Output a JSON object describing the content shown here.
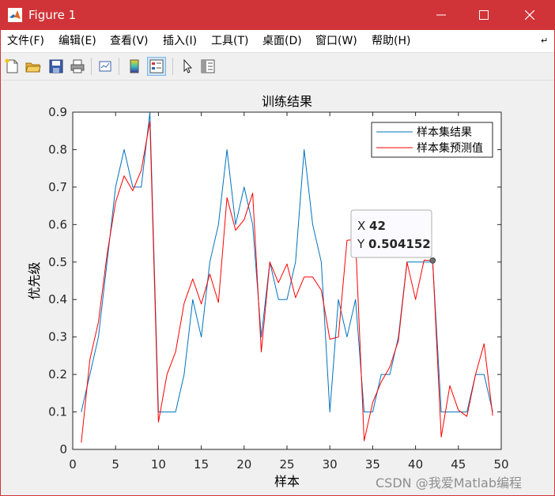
{
  "window": {
    "title": "Figure 1",
    "accent_color": "#d13438"
  },
  "menu": {
    "items": [
      "文件(F)",
      "编辑(E)",
      "查看(V)",
      "插入(I)",
      "工具(T)",
      "桌面(D)",
      "窗口(W)",
      "帮助(H)"
    ]
  },
  "toolbar": {
    "icons": [
      "new-figure-icon",
      "open-file-icon",
      "save-icon",
      "print-icon",
      "link-plot-icon",
      "colorbar-icon",
      "legend-icon",
      "pointer-icon",
      "property-editor-icon"
    ]
  },
  "watermark": "CSDN @我爱Matlab编程",
  "chart_data": {
    "type": "line",
    "title": "训练结果",
    "xlabel": "样本",
    "ylabel": "优先级",
    "xlim": [
      0,
      50
    ],
    "ylim": [
      0,
      0.9
    ],
    "xticks": [
      0,
      5,
      10,
      15,
      20,
      25,
      30,
      35,
      40,
      45,
      50
    ],
    "yticks": [
      0,
      0.1,
      0.2,
      0.3,
      0.4,
      0.5,
      0.6,
      0.7,
      0.8,
      0.9
    ],
    "legend_position": "top-right",
    "series": [
      {
        "name": "样本集结果",
        "color": "#0072bd",
        "x": [
          1,
          2,
          3,
          4,
          5,
          6,
          7,
          8,
          9,
          10,
          11,
          12,
          13,
          14,
          15,
          16,
          17,
          18,
          19,
          20,
          21,
          22,
          23,
          24,
          25,
          26,
          27,
          28,
          29,
          30,
          31,
          32,
          33,
          34,
          35,
          36,
          37,
          38,
          39,
          40,
          41,
          42,
          43,
          44,
          45,
          46,
          47,
          48,
          49
        ],
        "values": [
          0.1,
          0.2,
          0.3,
          0.5,
          0.7,
          0.8,
          0.7,
          0.7,
          0.9,
          0.1,
          0.1,
          0.1,
          0.2,
          0.4,
          0.3,
          0.5,
          0.6,
          0.8,
          0.6,
          0.7,
          0.6,
          0.3,
          0.5,
          0.4,
          0.4,
          0.5,
          0.8,
          0.6,
          0.5,
          0.1,
          0.4,
          0.3,
          0.4,
          0.1,
          0.1,
          0.2,
          0.2,
          0.3,
          0.5,
          0.5,
          0.5,
          0.5,
          0.1,
          0.1,
          0.1,
          0.1,
          0.2,
          0.2,
          0.1
        ]
      },
      {
        "name": "样本集预测值",
        "color": "#ff0000",
        "x": [
          1,
          2,
          3,
          4,
          5,
          6,
          7,
          8,
          9,
          10,
          11,
          12,
          13,
          14,
          15,
          16,
          17,
          18,
          19,
          20,
          21,
          22,
          23,
          24,
          25,
          26,
          27,
          28,
          29,
          30,
          31,
          32,
          33,
          34,
          35,
          36,
          37,
          38,
          39,
          40,
          41,
          42,
          43,
          44,
          45,
          46,
          47,
          48,
          49
        ],
        "values": [
          0.018,
          0.24,
          0.34,
          0.52,
          0.66,
          0.73,
          0.69,
          0.745,
          0.875,
          0.073,
          0.2,
          0.26,
          0.39,
          0.455,
          0.388,
          0.468,
          0.392,
          0.672,
          0.585,
          0.613,
          0.684,
          0.26,
          0.5,
          0.445,
          0.495,
          0.405,
          0.46,
          0.46,
          0.425,
          0.294,
          0.3,
          0.558,
          0.56,
          0.023,
          0.125,
          0.18,
          0.22,
          0.29,
          0.5,
          0.4,
          0.505,
          0.504,
          0.033,
          0.17,
          0.105,
          0.088,
          0.2,
          0.282,
          0.09
        ]
      }
    ],
    "datatip": {
      "x_label": "X",
      "x": 42,
      "y_label": "Y",
      "y": 0.504152
    }
  }
}
